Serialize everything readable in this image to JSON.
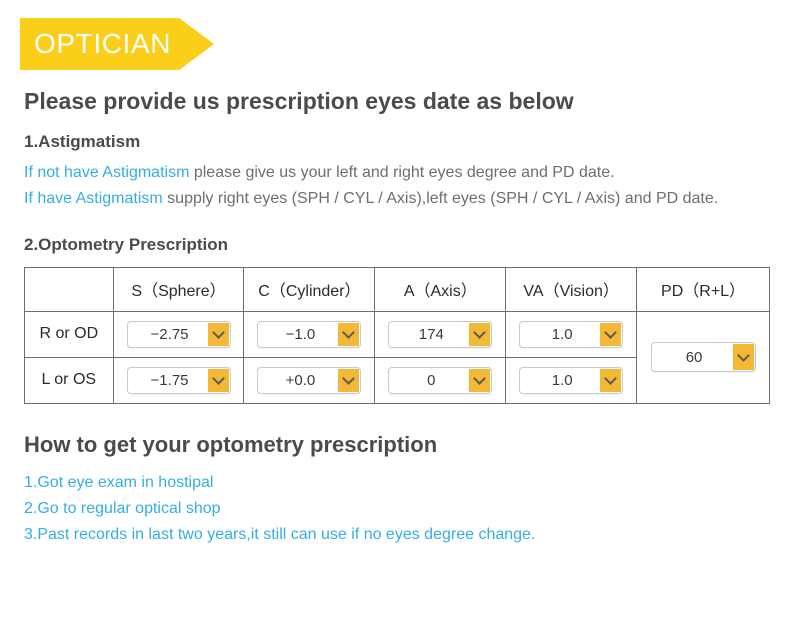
{
  "banner": {
    "label": "OPTICIAN",
    "color": "#FBCE1A",
    "text_color": "#ffffff"
  },
  "colors": {
    "accent_yellow": "#FBCE1A",
    "dropdown_yellow": "#F3B836",
    "link_blue": "#35AEE5",
    "body_gray": "#6e6e6e",
    "heading_gray": "#4b4b4b"
  },
  "headings": {
    "main": "Please provide us prescription eyes date as below",
    "section1": "1.Astigmatism",
    "section2": "2.Optometry Prescription",
    "section3": "How to get your optometry prescription"
  },
  "astigmatism": {
    "line1_blue": "If not have Astigmatism",
    "line1_rest": " please give us your left and right eyes degree and PD date.",
    "line2_blue": "If have Astigmatism",
    "line2_rest": " supply right eyes (SPH / CYL / Axis),left eyes (SPH / CYL / Axis) and PD date."
  },
  "table": {
    "headers": [
      "",
      "S（Sphere）",
      "C（Cylinder）",
      "A（Axis）",
      "VA（Vision）",
      "PD（R+L）"
    ],
    "rows": [
      {
        "label": "R or OD",
        "sphere": "−2.75",
        "cylinder": "−1.0",
        "axis": "174",
        "vision": "1.0"
      },
      {
        "label": "L or OS",
        "sphere": "−1.75",
        "cylinder": "+0.0",
        "axis": "0",
        "vision": "1.0"
      }
    ],
    "pd": "60"
  },
  "howto": {
    "items": [
      "1.Got eye exam in hostipal",
      "2.Go to regular optical shop",
      "3.Past records in last two years,it still can use if no eyes degree change."
    ]
  }
}
